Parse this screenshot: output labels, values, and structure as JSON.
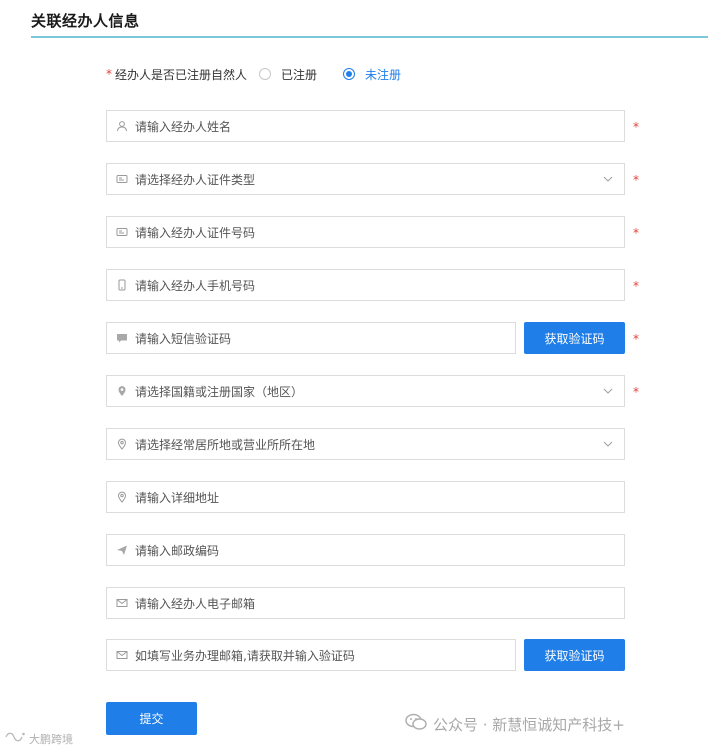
{
  "section": {
    "title": "关联经办人信息"
  },
  "registered_question": {
    "required_mark": "*",
    "label": "经办人是否已注册自然人",
    "options": [
      {
        "label": "已注册",
        "checked": false
      },
      {
        "label": "未注册",
        "checked": true
      }
    ]
  },
  "fields": {
    "name": {
      "placeholder": "请输入经办人姓名",
      "icon": "user-icon",
      "required": "*"
    },
    "id_type": {
      "placeholder": "请选择经办人证件类型",
      "icon": "id-card-icon",
      "required": "*"
    },
    "id_number": {
      "placeholder": "请输入经办人证件号码",
      "icon": "id-card-icon",
      "required": "*"
    },
    "phone": {
      "placeholder": "请输入经办人手机号码",
      "icon": "mobile-phone-icon",
      "required": "*"
    },
    "sms_code": {
      "placeholder": "请输入短信验证码",
      "icon": "message-icon",
      "required": "*"
    },
    "nationality": {
      "placeholder": "请选择国籍或注册国家（地区）",
      "icon": "location-pin-icon",
      "required": "*"
    },
    "residence": {
      "placeholder": "请选择经常居所地或营业所所在地",
      "icon": "location-pin-icon"
    },
    "address": {
      "placeholder": "请输入详细地址",
      "icon": "location-pin-icon"
    },
    "postal_code": {
      "placeholder": "请输入邮政编码",
      "icon": "send-icon"
    },
    "email": {
      "placeholder": "请输入经办人电子邮箱",
      "icon": "mail-icon"
    },
    "business_email": {
      "placeholder": "如填写业务办理邮箱,请获取并输入验证码",
      "icon": "mail-icon"
    }
  },
  "buttons": {
    "get_sms_code": "获取验证码",
    "get_email_code": "获取验证码",
    "submit": "提交"
  },
  "watermarks": {
    "right": "公众号 · 新慧恒诚知产科技+",
    "left": "大鹏跨境"
  },
  "colors": {
    "accent": "#1f7ee8",
    "required": "#e6403a",
    "title_underline": "#7ec8de"
  }
}
